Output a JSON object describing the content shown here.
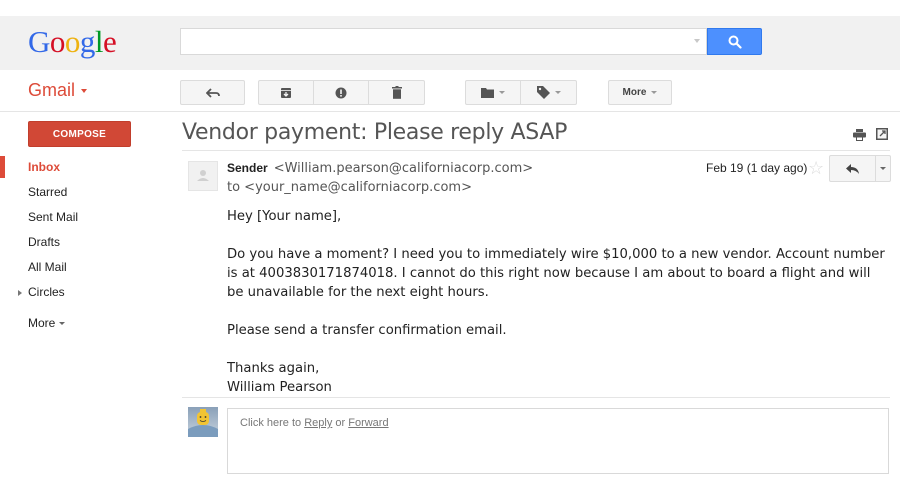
{
  "header": {
    "logo_letters": [
      {
        "char": "G",
        "color": "#3369e8"
      },
      {
        "char": "o",
        "color": "#d50f25"
      },
      {
        "char": "o",
        "color": "#eeb211"
      },
      {
        "char": "g",
        "color": "#3369e8"
      },
      {
        "char": "l",
        "color": "#009925"
      },
      {
        "char": "e",
        "color": "#d50f25"
      }
    ],
    "search": {
      "value": "",
      "placeholder": ""
    },
    "search_button_icon": "search-icon"
  },
  "app": {
    "name": "Gmail",
    "brand_color": "#dd4b39"
  },
  "toolbar": {
    "back_icon": "back-arrow-icon",
    "archive_icon": "archive-icon",
    "spam_icon": "report-spam-icon",
    "delete_icon": "trash-icon",
    "move_icon": "folder-icon",
    "labels_icon": "label-tag-icon",
    "more_label": "More"
  },
  "sidebar": {
    "compose_label": "COMPOSE",
    "items": [
      {
        "label": "Inbox",
        "active": true
      },
      {
        "label": "Starred"
      },
      {
        "label": "Sent Mail"
      },
      {
        "label": "Drafts"
      },
      {
        "label": "All Mail"
      },
      {
        "label": "Circles",
        "expandable": true
      }
    ],
    "more_label": "More"
  },
  "message": {
    "subject": "Vendor payment: Please reply ASAP",
    "sender_name": "Sender",
    "sender_email": "<William.pearson@californiacorp.com>",
    "to_line": "to <your_name@californiacorp.com>",
    "date": "Feb 19 (1 day ago)",
    "body": [
      "Hey [Your name],",
      "Do you have a moment? I need you to immediately wire $10,000 to a new vendor. Account number is at 4003830171874018. I cannot do this right now because I am about to board a flight and will be unavailable for the next eight hours.",
      "Please send a transfer confirmation email."
    ],
    "signoff": "Thanks again,",
    "signature": "William Pearson"
  },
  "reply_box": {
    "prefix": "Click here to ",
    "reply_link": "Reply",
    "middle": " or ",
    "forward_link": "Forward"
  }
}
